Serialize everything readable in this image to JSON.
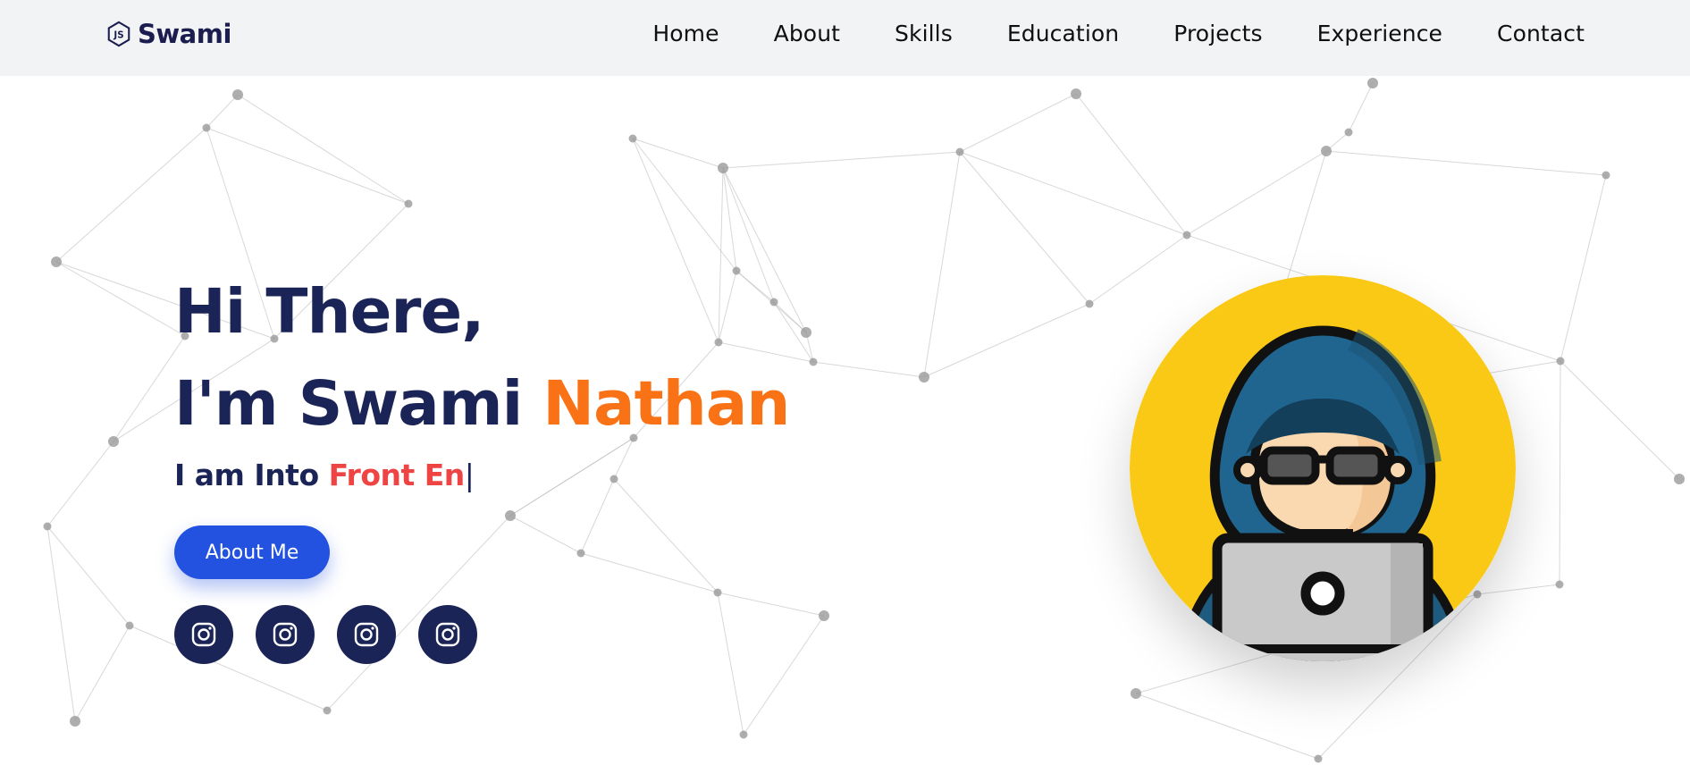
{
  "brand": {
    "name": "Swami",
    "logo_icon": "js-hexagon-icon"
  },
  "nav": {
    "items": [
      {
        "label": "Home"
      },
      {
        "label": "About"
      },
      {
        "label": "Skills"
      },
      {
        "label": "Education"
      },
      {
        "label": "Projects"
      },
      {
        "label": "Experience"
      },
      {
        "label": "Contact"
      }
    ]
  },
  "hero": {
    "greeting": "Hi There,",
    "name_prefix": "I'm Swami ",
    "name_highlight": "Nathan",
    "typing_prefix": "I am Into ",
    "typing_text": "Front En",
    "typing_cursor": "|",
    "button_label": "About Me",
    "socials": [
      {
        "icon": "instagram-icon"
      },
      {
        "icon": "instagram-icon"
      },
      {
        "icon": "instagram-icon"
      },
      {
        "icon": "instagram-icon"
      }
    ]
  },
  "avatar": {
    "icon": "hacker-with-laptop-icon"
  },
  "colors": {
    "navy": "#1b2456",
    "accent_orange": "#f97316",
    "accent_red": "#ef4444",
    "button_blue": "#2452e0",
    "avatar_bg": "#f9c916",
    "navbar_bg": "#f2f3f5"
  }
}
